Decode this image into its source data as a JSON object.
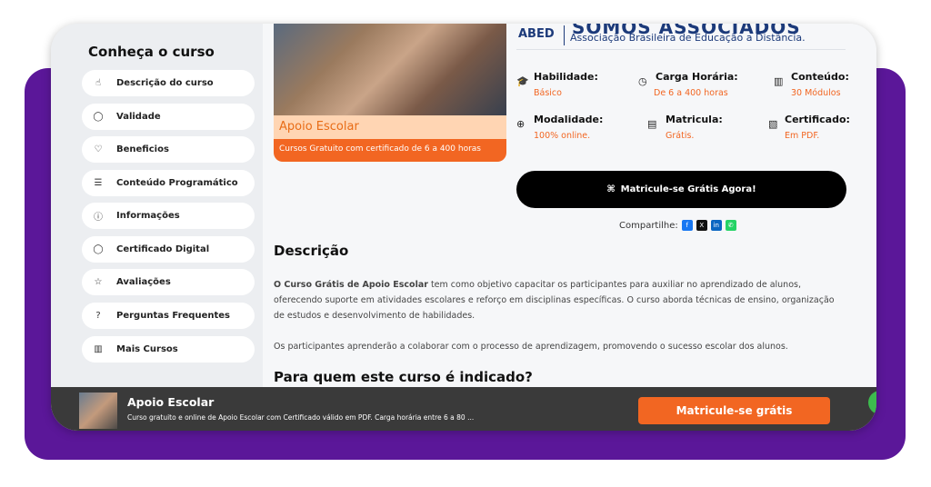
{
  "sidebar": {
    "title": "Conheça o curso",
    "items": [
      {
        "icon": "hand-icon",
        "glyph": "☝",
        "label": "Descrição do curso"
      },
      {
        "icon": "shield-icon",
        "glyph": "◯",
        "label": "Validade"
      },
      {
        "icon": "heart-icon",
        "glyph": "♡",
        "label": "Beneficios"
      },
      {
        "icon": "list-icon",
        "glyph": "☰",
        "label": "Conteúdo Programático"
      },
      {
        "icon": "info-icon",
        "glyph": "ⓘ",
        "label": "Informações"
      },
      {
        "icon": "certificate-icon",
        "glyph": "◯",
        "label": "Certificado Digital"
      },
      {
        "icon": "star-icon",
        "glyph": "☆",
        "label": "Avaliações"
      },
      {
        "icon": "question-icon",
        "glyph": "?",
        "label": "Perguntas Frequentes"
      },
      {
        "icon": "books-icon",
        "glyph": "▥",
        "label": "Mais Cursos"
      }
    ]
  },
  "hero": {
    "title": "Apoio Escolar",
    "subtitle": "Cursos Gratuito com certificado de 6 a 400 horas"
  },
  "abed": {
    "logo": "ABED",
    "title": "SOMOS ASSOCIADOS",
    "subtitle": "Associação Brasileira de Educação a Distância."
  },
  "info": {
    "habilidade": {
      "label": "Habilidade:",
      "value": "Básico"
    },
    "carga": {
      "label": "Carga Horária:",
      "value": "De 6 a 400 horas"
    },
    "conteudo": {
      "label": "Conteúdo:",
      "value": "30 Módulos"
    },
    "modalidade": {
      "label": "Modalidade:",
      "value": "100% online."
    },
    "matricula": {
      "label": "Matricula:",
      "value": "Grátis."
    },
    "certificado": {
      "label": "Certificado:",
      "value": "Em PDF."
    }
  },
  "cta": {
    "label": "Matricule-se Grátis Agora!"
  },
  "share": {
    "label": "Compartilhe:",
    "icons": [
      "facebook-icon",
      "x-icon",
      "linkedin-icon",
      "whatsapp-icon"
    ]
  },
  "descricao": {
    "heading": "Descrição",
    "para1_bold": "O Curso Grátis de Apoio Escolar",
    "para1_rest": " tem como objetivo capacitar os participantes para auxiliar no aprendizado de alunos, oferecendo suporte em atividades escolares e reforço em disciplinas específicas. O curso aborda técnicas de ensino, organização de estudos e desenvolvimento de habilidades.",
    "para2": "Os participantes aprenderão a colaborar com o processo de aprendizagem, promovendo o sucesso escolar dos alunos."
  },
  "indicado": {
    "heading": "Para quem este curso é indicado?"
  },
  "bottom_bar": {
    "title": "Apoio Escolar",
    "subtitle": "Curso gratuito e online de Apoio Escolar com Certificado válido em PDF. Carga horária entre 6 a 80 ...",
    "button": "Matricule-se grátis"
  },
  "colors": {
    "accent": "#f26622",
    "purple": "#5b1799",
    "navy": "#1c3a7a"
  }
}
